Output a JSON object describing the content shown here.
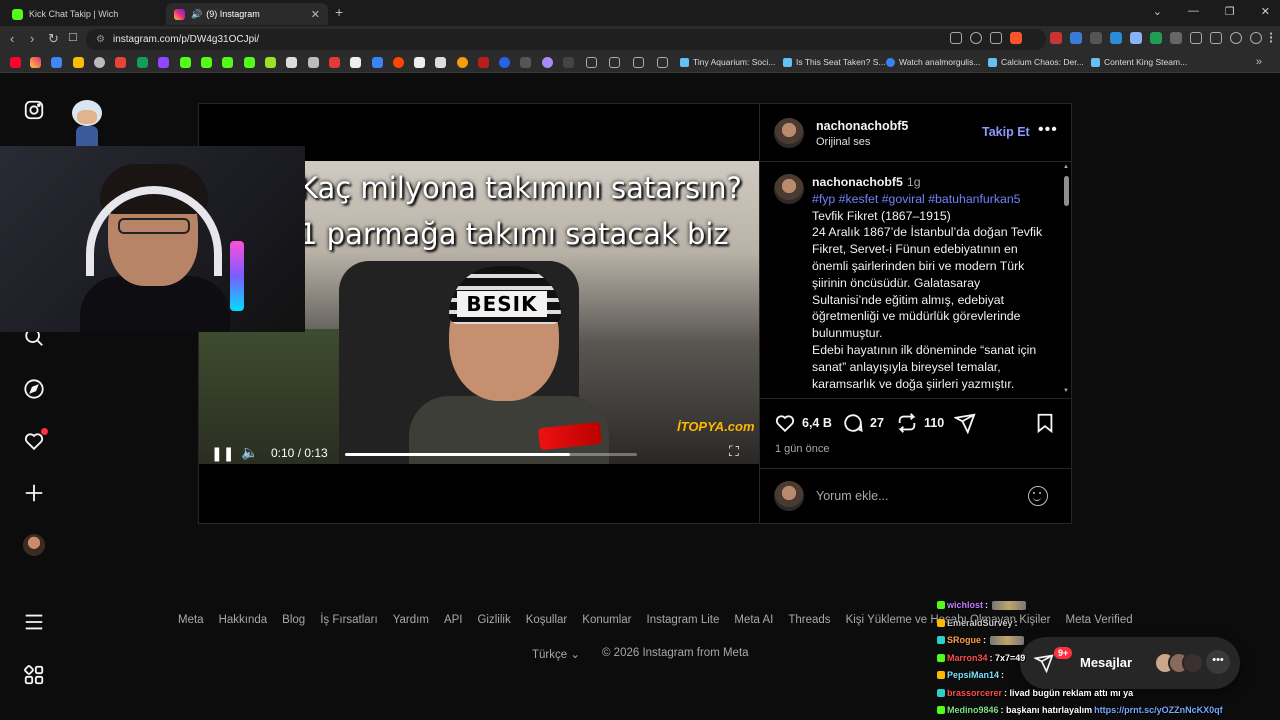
{
  "browser": {
    "tabs": [
      {
        "label": "Kick Chat Takip | Wich",
        "favicon_color": "#53fc18",
        "active": false
      },
      {
        "label": "(9) Instagram",
        "favicon_color": "#e1306c",
        "active": true
      }
    ],
    "new_tab": "+",
    "url": "instagram.com/p/DW4g31OCJpi/",
    "bookmarks": [
      {
        "label": "Tiny Aquarium: Soci..."
      },
      {
        "label": "Is This Seat Taken? S..."
      },
      {
        "label": "Watch analmorgulis..."
      },
      {
        "label": "Calcium Chaos: Der..."
      },
      {
        "label": "Content King Steam..."
      }
    ]
  },
  "post": {
    "video": {
      "caption_line1": "Kaç milyona takımını satarsın?",
      "caption_line2": "1 parmağa takımı satacak biz",
      "beanie_text": "BESIK",
      "time": "0:10 / 0:13",
      "progress": 0.77,
      "watermark": "İTOPYA.com"
    },
    "author": {
      "username": "nachonachobf5",
      "audio": "Orijinal ses",
      "follow_label": "Takip Et",
      "more": "•••"
    },
    "caption": {
      "username": "nachonachobf5",
      "time": "1g",
      "hashtags": "#fyp #kesfet #goviral #batuhanfurkan5",
      "lines": [
        "Tevfik Fikret (1867–1915)",
        "24 Aralık 1867’de İstanbul’da doğan Tevfik Fikret, Servet-i Fünun edebiyatının en önemli şairlerinden biri ve modern Türk şiirinin öncüsüdür. Galatasaray Sultanisi’nde eğitim almış, edebiyat öğretmenliği ve müdürlük görevlerinde bulunmuştur.",
        "Edebi hayatının ilk döneminde “sanat için sanat” anlayışıyla bireysel temalar, karamsarlık ve doğa şiirleri yazmıştır."
      ]
    },
    "likes": "6,4 B",
    "comments": "27",
    "reposts": "110",
    "posted_ago": "1 gün önce",
    "comment_placeholder": "Yorum ekle..."
  },
  "footer": {
    "links": [
      "Meta",
      "Hakkında",
      "Blog",
      "İş Fırsatları",
      "Yardım",
      "API",
      "Gizlilik",
      "Koşullar",
      "Konumlar",
      "Instagram Lite",
      "Meta AI",
      "Threads",
      "Kişi Yükleme ve Hesabı Olmayan Kişiler",
      "Meta Verified"
    ],
    "language": "Türkçe",
    "copyright": "© 2026 Instagram from Meta"
  },
  "messages": {
    "label": "Mesajlar",
    "badge": "9+",
    "more": "•••"
  },
  "stream_chat": [
    {
      "user": "wichlost",
      "color": "#c77dff",
      "text": ":",
      "emote": true
    },
    {
      "user": "EmeraldSurvey",
      "color": "#c9c9c9",
      "text": ":",
      "emote": false
    },
    {
      "user": "SRogue",
      "color": "#ff9f43",
      "text": ":",
      "emote": true
    },
    {
      "user": "Marron34",
      "color": "#ff4d4d",
      "text": ": 7x7=49",
      "emote": false
    },
    {
      "user": "PepsiMan14",
      "color": "#7ee0ff",
      "text": ":",
      "emote": false
    },
    {
      "user": "brassorcerer",
      "color": "#ff4d4d",
      "text": ": livad bugün reklam attı mı ya",
      "emote": false
    },
    {
      "user": "Medino9846",
      "color": "#7ee08a",
      "text": ": başkanı hatırlayalım",
      "link": "https://prnt.sc/yOZZnNcKX0qf",
      "emote": false
    }
  ],
  "colors": {
    "link_blue": "#6f83ff",
    "follow_blue": "#8d9bff",
    "notification_red": "#ff3040",
    "background": "#0c0c0c"
  }
}
